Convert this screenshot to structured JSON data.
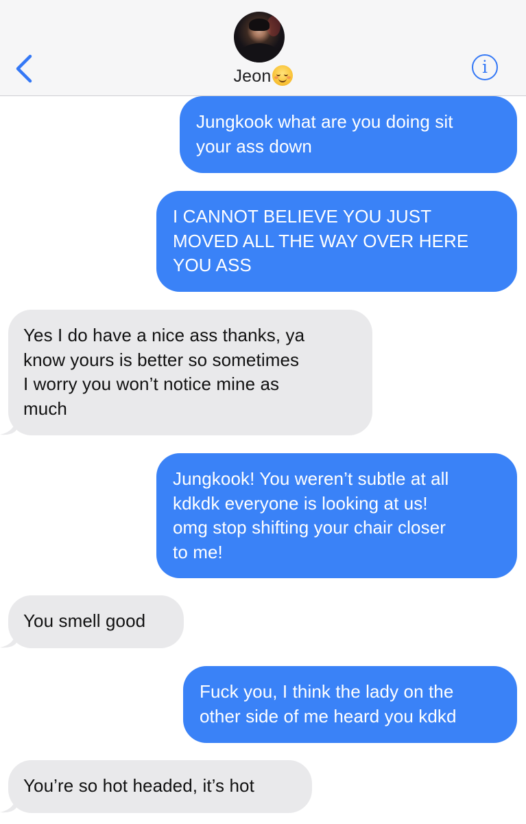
{
  "header": {
    "back_icon": "chevron-left-icon",
    "contact_name": "Jeon",
    "contact_emoji": "relieved-smiling-face-emoji",
    "info_glyph": "i",
    "accent_color": "#3478f6"
  },
  "messages": [
    {
      "direction": "sent",
      "lines": [
        "Jungkook what are you doing sit",
        "your ass down"
      ]
    },
    {
      "direction": "sent",
      "lines": [
        "I CANNOT BELIEVE YOU JUST",
        "MOVED ALL THE WAY OVER HERE",
        "YOU ASS"
      ]
    },
    {
      "direction": "received",
      "lines": [
        "Yes I do have a nice ass thanks, ya",
        "know yours is  better so sometimes",
        "I worry you won’t notice mine as",
        "much"
      ]
    },
    {
      "direction": "sent",
      "lines": [
        "Jungkook! You weren’t subtle at all",
        "kdkdk everyone is looking at us!",
        "omg stop shifting your chair closer",
        "to me!"
      ]
    },
    {
      "direction": "received",
      "lines": [
        "You smell good"
      ]
    },
    {
      "direction": "sent",
      "lines": [
        "Fuck you, I think the lady on the",
        "other side of me heard you kdkd"
      ]
    },
    {
      "direction": "received",
      "lines": [
        "You’re so hot headed, it’s hot"
      ]
    }
  ],
  "colors": {
    "sent_bubble": "#3a82f7",
    "received_bubble": "#e9e9eb",
    "header_bg": "#f6f6f7"
  }
}
